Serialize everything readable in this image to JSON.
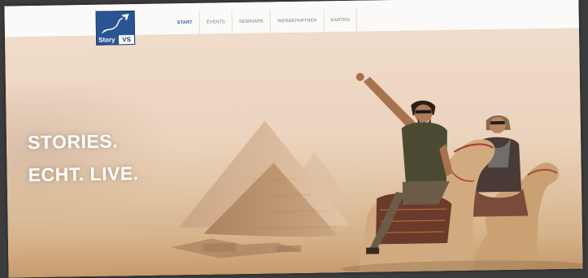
{
  "logo": {
    "story_text": "Story",
    "vs_text": "VS",
    "icon": "kite-rocket-icon",
    "brand_color": "#2a5592"
  },
  "nav": {
    "items": [
      {
        "label": "START",
        "active": true
      },
      {
        "label": "EVENTS",
        "active": false
      },
      {
        "label": "SEMINARE",
        "active": false
      },
      {
        "label": "WERBEPARTNER",
        "active": false
      },
      {
        "label": "KARTEN",
        "active": false
      }
    ]
  },
  "hero": {
    "line1": "STORIES.",
    "line2": "ECHT. LIVE."
  }
}
